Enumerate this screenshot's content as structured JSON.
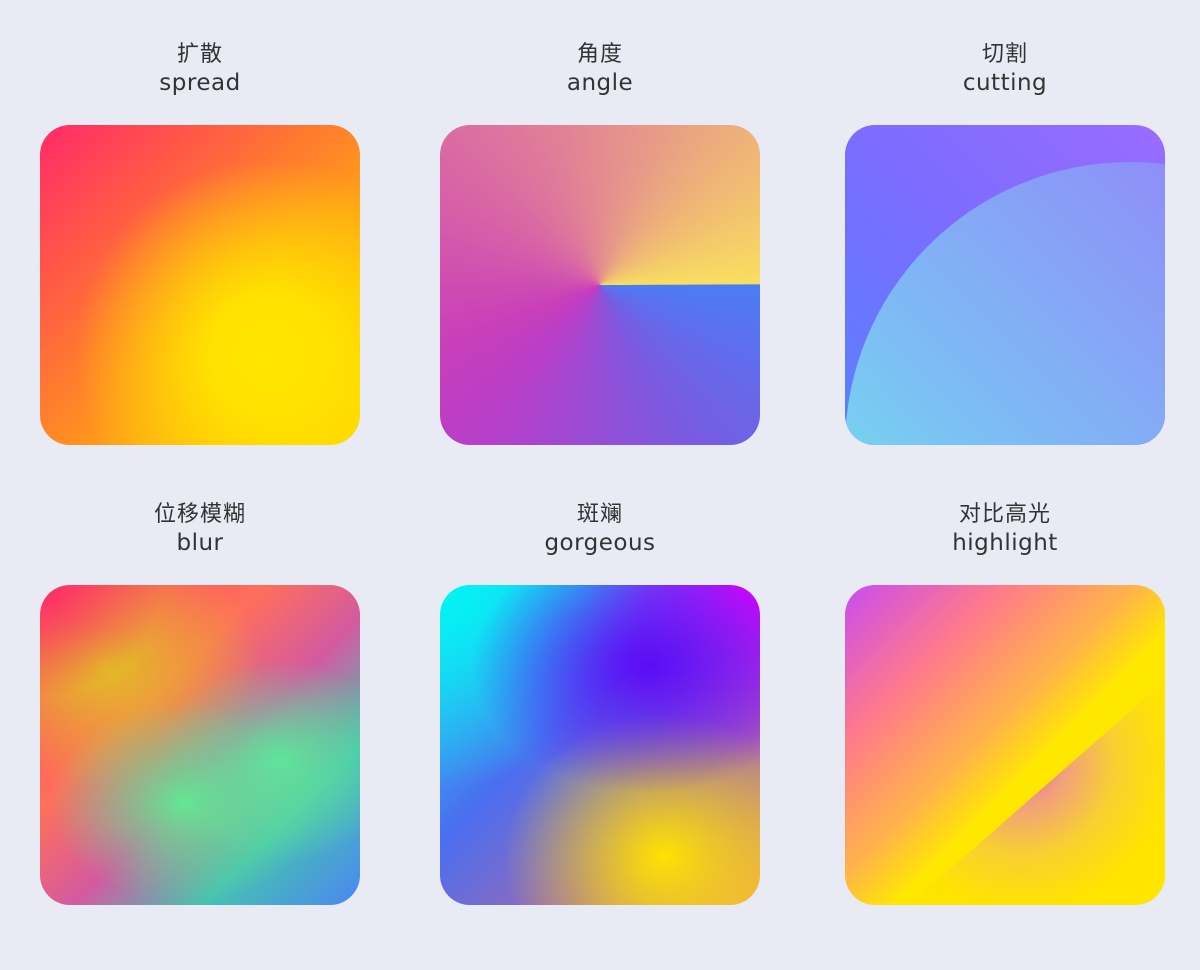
{
  "background_color": "#e8eaf4",
  "cards": [
    {
      "title_zh": "扩散",
      "title_en": "spread"
    },
    {
      "title_zh": "角度",
      "title_en": "angle"
    },
    {
      "title_zh": "切割",
      "title_en": "cutting"
    },
    {
      "title_zh": "位移模糊",
      "title_en": "blur"
    },
    {
      "title_zh": "斑斓",
      "title_en": "gorgeous"
    },
    {
      "title_zh": "对比高光",
      "title_en": "highlight"
    }
  ]
}
